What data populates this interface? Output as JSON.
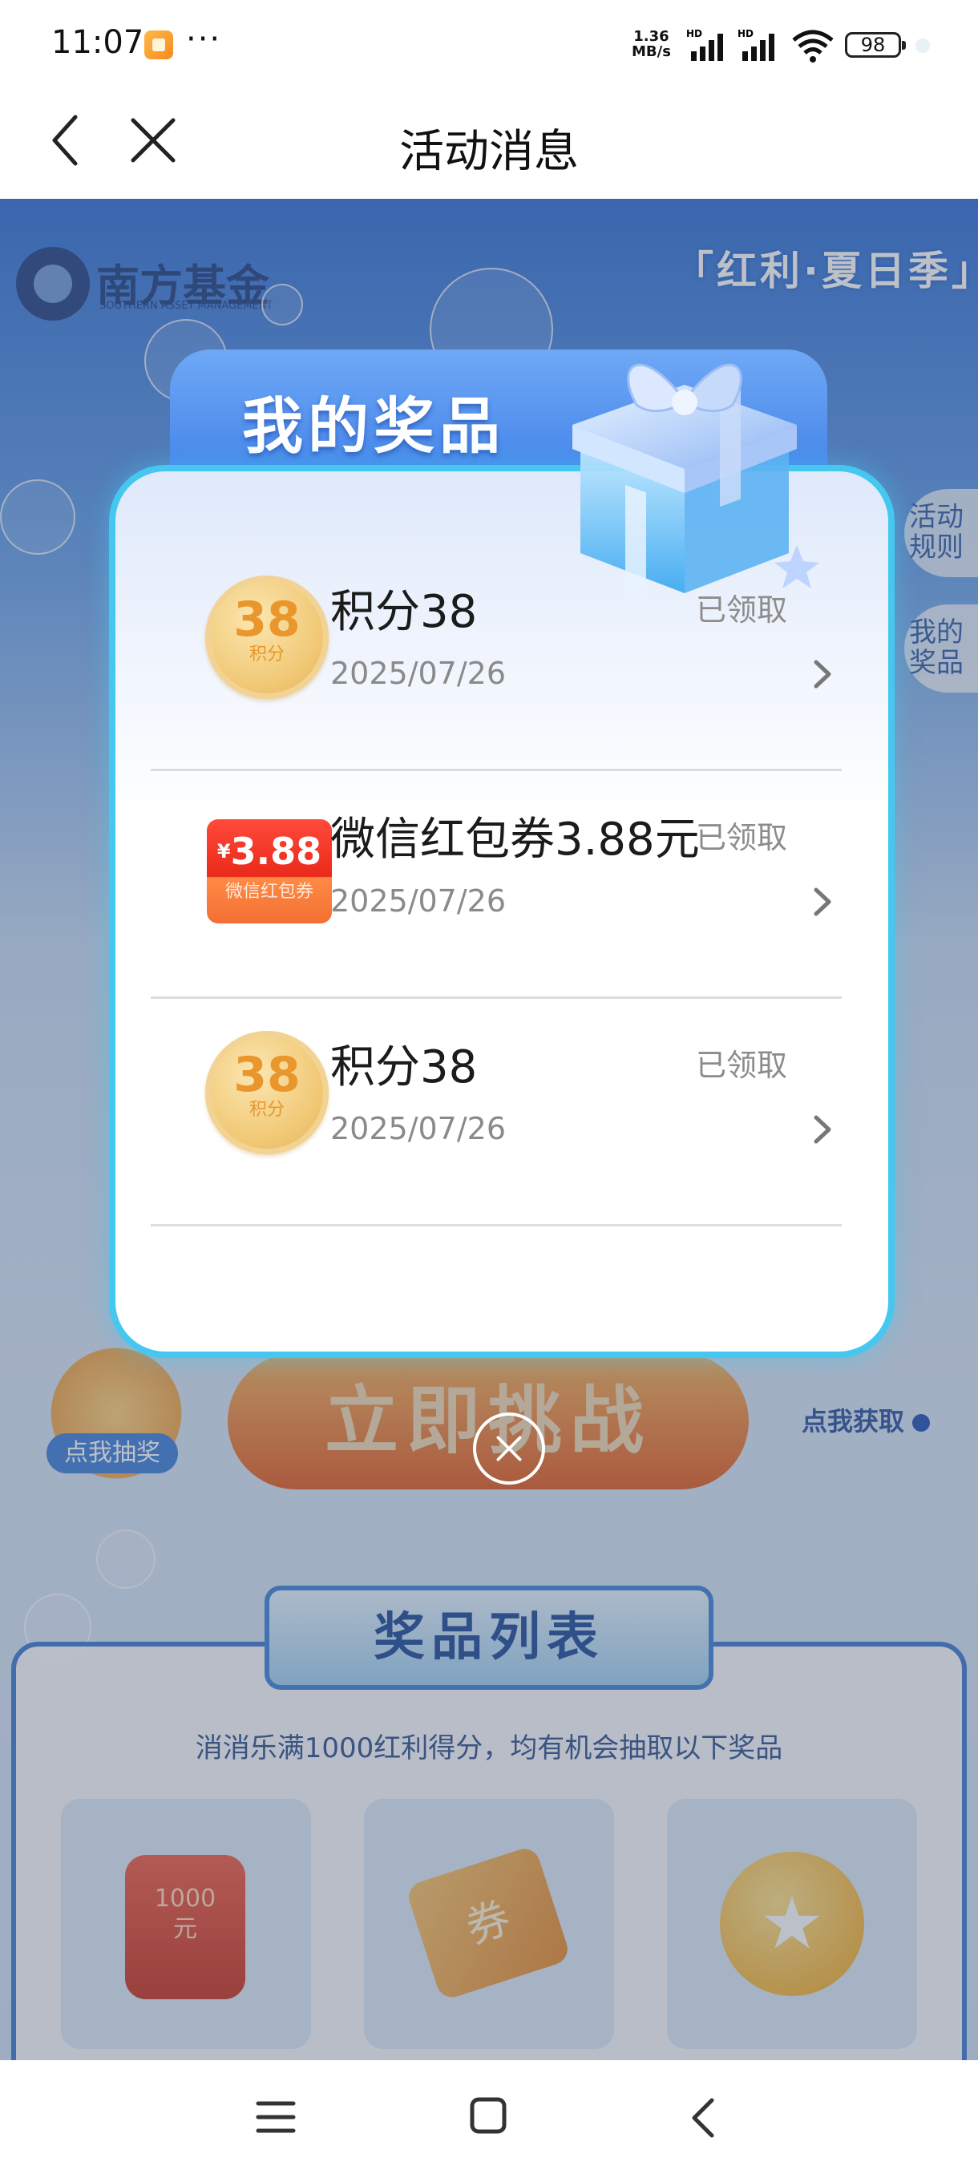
{
  "status_bar": {
    "time": "11:07",
    "dots": "···",
    "speed_value": "1.36",
    "speed_unit": "MB/s",
    "hd1": "HD",
    "hd2": "HD",
    "battery": "98"
  },
  "nav": {
    "title": "活动消息",
    "back_icon": "chevron-left-icon",
    "close_icon": "close-icon"
  },
  "background": {
    "logo_cn": "南方基金",
    "logo_en": "SOUTHERN ASSET MANAGEMENT",
    "season": "「红利·夏日季」",
    "side_rules": "活动\n规则",
    "side_my_prizes": "我的\n奖品",
    "challenge_button": "立即挑战",
    "lottery_label": "点我抽奖",
    "get_chance": "点我获取",
    "prize_list_title": "奖品列表",
    "prize_list_desc": "消消乐满1000红利得分，均有机会抽取以下奖品",
    "prize_cards": [
      {
        "text": "1000\n元"
      },
      {
        "text": "券"
      },
      {
        "text": "★"
      }
    ]
  },
  "modal": {
    "title": "我的奖品",
    "items": [
      {
        "name": "积分38",
        "date": "2025/07/26",
        "status": "已领取",
        "icon": {
          "type": "points-coin-icon",
          "value": "38",
          "label": "积分"
        }
      },
      {
        "name": "微信红包券3.88元",
        "date": "2025/07/26",
        "status": "已领取",
        "icon": {
          "type": "wechat-red-packet-icon",
          "currency": "¥",
          "value": "3.88",
          "label": "微信红包券"
        }
      },
      {
        "name": "积分38",
        "date": "2025/07/26",
        "status": "已领取",
        "icon": {
          "type": "points-coin-icon",
          "value": "38",
          "label": "积分"
        }
      }
    ]
  },
  "colors": {
    "accent_blue": "#3f7fe8",
    "modal_border": "#46c7f0",
    "coin_text": "#e9972c",
    "redpacket_red": "#ea2a1a"
  }
}
